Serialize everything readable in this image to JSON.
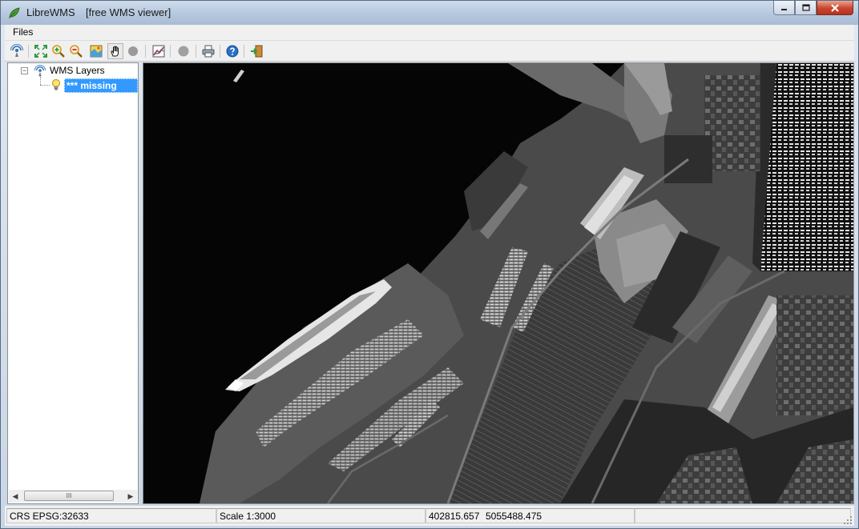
{
  "window": {
    "title": "LibreWMS",
    "subtitle": "[free WMS viewer]"
  },
  "menu": {
    "files_label": "Files"
  },
  "toolbar": {
    "buttons": [
      {
        "icon": "wms-connect-icon"
      },
      {
        "icon": "zoom-extent-icon"
      },
      {
        "icon": "zoom-in-icon"
      },
      {
        "icon": "zoom-out-icon"
      },
      {
        "icon": "full-map-icon"
      },
      {
        "icon": "pan-hand-icon",
        "active": true
      },
      {
        "icon": "disabled-circle-icon"
      },
      {
        "icon": "layer-info-icon"
      },
      {
        "icon": "disabled-stop-icon"
      },
      {
        "icon": "print-icon"
      },
      {
        "icon": "help-icon"
      },
      {
        "icon": "exit-icon"
      }
    ]
  },
  "tree": {
    "root_label": "WMS Layers",
    "expander": "−",
    "child_label": "*** missing Title",
    "scroll_thumb_glyph": "III"
  },
  "status": {
    "crs": "CRS EPSG:32633",
    "scale": "Scale 1:3000",
    "x": "402815.657",
    "y": "5055488.475"
  },
  "colors": {
    "selection": "#3399ff",
    "close_button": "#c8452d",
    "map_water": "#050505"
  }
}
